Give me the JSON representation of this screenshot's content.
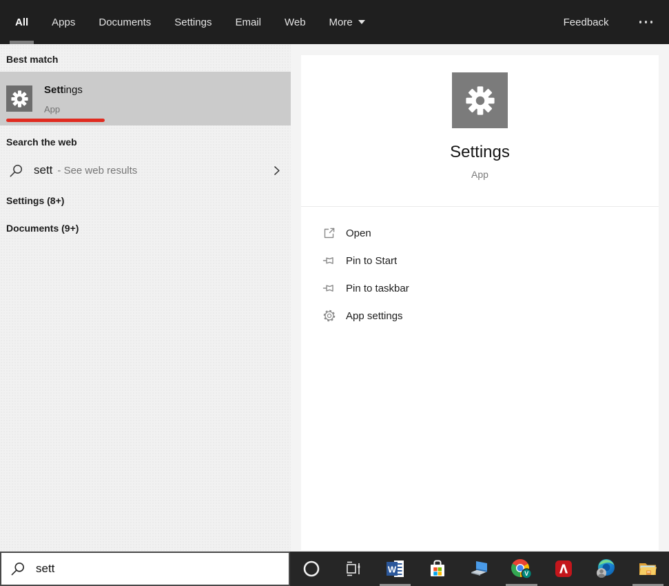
{
  "topbar": {
    "tabs": [
      {
        "label": "All",
        "active": true
      },
      {
        "label": "Apps",
        "active": false
      },
      {
        "label": "Documents",
        "active": false
      },
      {
        "label": "Settings",
        "active": false
      },
      {
        "label": "Email",
        "active": false
      },
      {
        "label": "Web",
        "active": false
      },
      {
        "label": "More",
        "active": false,
        "has_dropdown": true
      }
    ],
    "feedback_label": "Feedback",
    "more_options_icon": "ellipsis-icon"
  },
  "left_panel": {
    "best_match_header": "Best match",
    "best_match": {
      "title_bold": "Sett",
      "title_rest": "ings",
      "subtitle": "App",
      "icon": "settings-gear-icon",
      "selected": true,
      "annotation": "red-underline"
    },
    "search_web_header": "Search the web",
    "web_row": {
      "query": "sett",
      "suffix": "- See web results",
      "icon": "search-icon",
      "chevron": "chevron-right-icon"
    },
    "groups": [
      {
        "label": "Settings (8+)"
      },
      {
        "label": "Documents (9+)"
      }
    ]
  },
  "preview_panel": {
    "title": "Settings",
    "subtitle": "App",
    "icon": "settings-gear-icon",
    "actions": [
      {
        "label": "Open",
        "icon": "open-icon"
      },
      {
        "label": "Pin to Start",
        "icon": "pin-icon"
      },
      {
        "label": "Pin to taskbar",
        "icon": "pin-icon"
      },
      {
        "label": "App settings",
        "icon": "gear-outline-icon"
      }
    ]
  },
  "search_bar": {
    "value": "sett",
    "icon": "search-icon"
  },
  "taskbar": {
    "buttons": [
      {
        "name": "cortana",
        "running": false
      },
      {
        "name": "task-view",
        "running": false
      },
      {
        "name": "word",
        "running": true
      },
      {
        "name": "microsoft-store",
        "running": false
      },
      {
        "name": "pc",
        "running": false
      },
      {
        "name": "chrome",
        "running": true
      },
      {
        "name": "acrobat-reader",
        "running": false
      },
      {
        "name": "edge",
        "running": false
      },
      {
        "name": "file-explorer",
        "running": true
      }
    ]
  },
  "colors": {
    "topbar_bg": "#1f1f1f",
    "left_panel_bg": "#f1f1f1",
    "selected_item_bg": "#cbcbcb",
    "annotation_red": "#e02b20",
    "tile_gray": "#6d6d6d",
    "taskbar_bg": "#262626",
    "ms_red": "#f25022",
    "ms_green": "#7fba00",
    "ms_blue": "#00a4ef",
    "ms_yellow": "#ffb900",
    "word_blue": "#2b579a",
    "acrobat_red": "#c4161c"
  }
}
